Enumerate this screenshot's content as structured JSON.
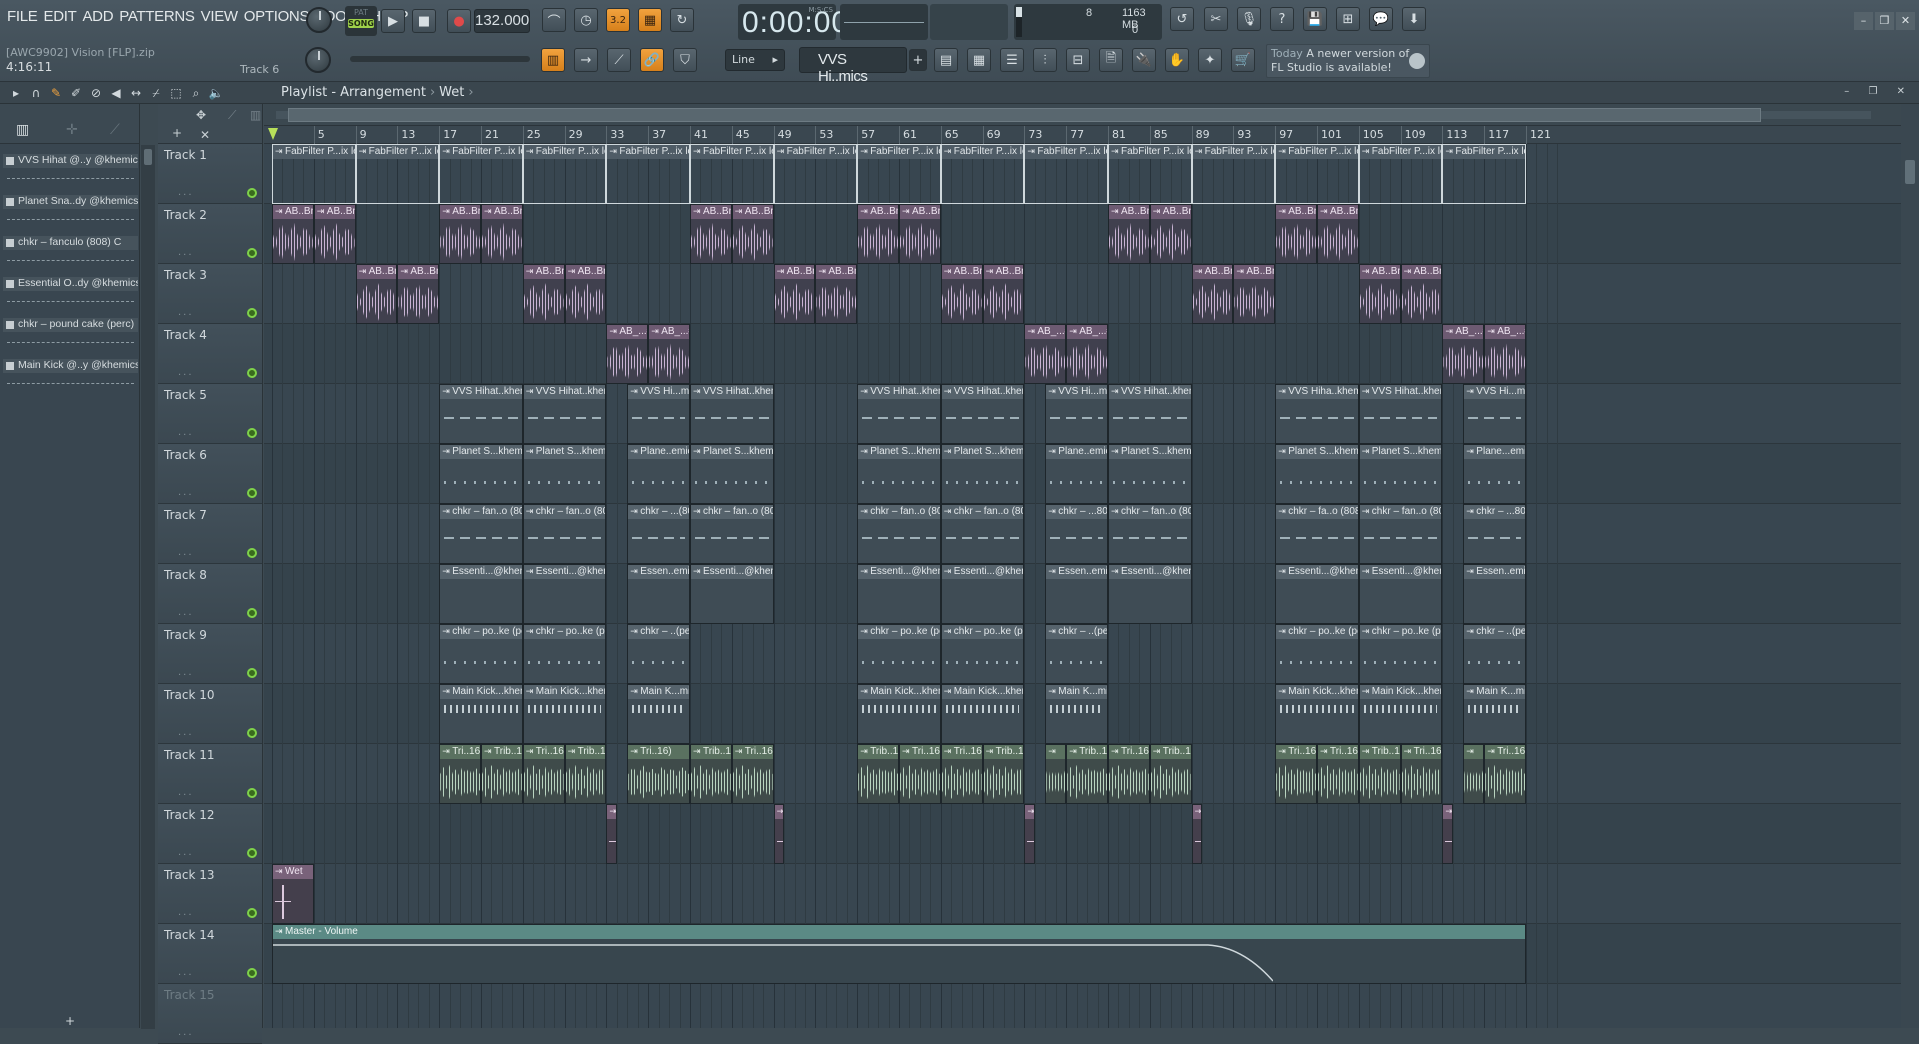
{
  "menu": [
    "FILE",
    "EDIT",
    "ADD",
    "PATTERNS",
    "VIEW",
    "OPTIONS",
    "TOOLS",
    "HELP"
  ],
  "transport": {
    "pat_label": "PAT",
    "song_label": "SONG",
    "tempo": "132.000",
    "time": "0:00:00",
    "time_unit": "M:S:CS"
  },
  "project": {
    "name": "[AWC9902] Vision [FLP].zip",
    "time": "4:16:11",
    "current_track": "Track 6"
  },
  "cpu": {
    "value1": "8",
    "ram": "1163 MB",
    "polyphony": "0"
  },
  "snap": "Line",
  "pattern_selector": "VVS Hi..mics_",
  "hint": {
    "label": "Today",
    "text": "A newer version of FL Studio is available!"
  },
  "playlist": {
    "title": "Playlist - Arrangement",
    "sub": "Wet"
  },
  "picker": [
    {
      "name": "VVS Hihat @..y @khemics_"
    },
    {
      "name": "Planet Sna..dy @khemics_"
    },
    {
      "name": "chkr – fanculo (808) C"
    },
    {
      "name": "Essential O..dy @khemics_"
    },
    {
      "name": "chkr – pound cake (perc)"
    },
    {
      "name": "Main Kick @..y @khemics_"
    }
  ],
  "ruler_labels": [
    "5",
    "9",
    "13",
    "17",
    "21",
    "25",
    "29",
    "33",
    "37",
    "41",
    "45",
    "49",
    "53",
    "57",
    "61",
    "65",
    "69",
    "73",
    "77",
    "81",
    "85",
    "89",
    "93",
    "97",
    "101",
    "105",
    "109",
    "113",
    "117",
    "121"
  ],
  "tracks": [
    "Track 1",
    "Track 2",
    "Track 3",
    "Track 4",
    "Track 5",
    "Track 6",
    "Track 7",
    "Track 8",
    "Track 9",
    "Track 10",
    "Track 11",
    "Track 12",
    "Track 13",
    "Track 14",
    "Track 15"
  ],
  "clips": [
    {
      "track": 0,
      "start": 1,
      "len": 8,
      "type": "automation",
      "label": "FabFilter P...ix level"
    },
    {
      "track": 0,
      "start": 9,
      "len": 8,
      "type": "automation",
      "label": "FabFilter P...ix level"
    },
    {
      "track": 0,
      "start": 17,
      "len": 8,
      "type": "automation",
      "label": "FabFilter P...ix level"
    },
    {
      "track": 0,
      "start": 25,
      "len": 8,
      "type": "automation",
      "label": "FabFilter P...ix level"
    },
    {
      "track": 0,
      "start": 33,
      "len": 8,
      "type": "automation",
      "label": "FabFilter P...ix level"
    },
    {
      "track": 0,
      "start": 41,
      "len": 8,
      "type": "automation",
      "label": "FabFilter P...ix level"
    },
    {
      "track": 0,
      "start": 49,
      "len": 8,
      "type": "automation",
      "label": "FabFilter P...ix level"
    },
    {
      "track": 0,
      "start": 57,
      "len": 8,
      "type": "automation",
      "label": "FabFilter P...ix level"
    },
    {
      "track": 0,
      "start": 65,
      "len": 8,
      "type": "automation",
      "label": "FabFilter P...ix level"
    },
    {
      "track": 0,
      "start": 73,
      "len": 8,
      "type": "automation",
      "label": "FabFilter P...ix level"
    },
    {
      "track": 0,
      "start": 81,
      "len": 8,
      "type": "automation",
      "label": "FabFilter P...ix level"
    },
    {
      "track": 0,
      "start": 89,
      "len": 8,
      "type": "automation",
      "label": "FabFilter P...ix level"
    },
    {
      "track": 0,
      "start": 97,
      "len": 8,
      "type": "automation",
      "label": "FabFilter P...ix level"
    },
    {
      "track": 0,
      "start": 105,
      "len": 8,
      "type": "automation",
      "label": "FabFilter P...ix level"
    },
    {
      "track": 0,
      "start": 113,
      "len": 8,
      "type": "automation",
      "label": "FabFilter P...ix level"
    },
    {
      "track": 1,
      "start": 1,
      "len": 4,
      "type": "audio-ab",
      "label": "AB..Bm"
    },
    {
      "track": 1,
      "start": 5,
      "len": 4,
      "type": "audio-ab",
      "label": "AB..Bm"
    },
    {
      "track": 1,
      "start": 17,
      "len": 4,
      "type": "audio-ab",
      "label": "AB..Bm"
    },
    {
      "track": 1,
      "start": 21,
      "len": 4,
      "type": "audio-ab",
      "label": "AB..Bm"
    },
    {
      "track": 1,
      "start": 41,
      "len": 4,
      "type": "audio-ab",
      "label": "AB..Bm"
    },
    {
      "track": 1,
      "start": 45,
      "len": 4,
      "type": "audio-ab",
      "label": "AB..Bm"
    },
    {
      "track": 1,
      "start": 57,
      "len": 4,
      "type": "audio-ab",
      "label": "AB..Bm"
    },
    {
      "track": 1,
      "start": 61,
      "len": 4,
      "type": "audio-ab",
      "label": "AB..Bm"
    },
    {
      "track": 1,
      "start": 81,
      "len": 4,
      "type": "audio-ab",
      "label": "AB..Bm"
    },
    {
      "track": 1,
      "start": 85,
      "len": 4,
      "type": "audio-ab",
      "label": "AB..Bm"
    },
    {
      "track": 1,
      "start": 97,
      "len": 4,
      "type": "audio-ab",
      "label": "AB..Bm"
    },
    {
      "track": 1,
      "start": 101,
      "len": 4,
      "type": "audio-ab",
      "label": "AB..Bm"
    },
    {
      "track": 2,
      "start": 9,
      "len": 4,
      "type": "audio-ab",
      "label": "AB..Bm"
    },
    {
      "track": 2,
      "start": 13,
      "len": 4,
      "type": "audio-ab",
      "label": "AB..Bm"
    },
    {
      "track": 2,
      "start": 25,
      "len": 4,
      "type": "audio-ab",
      "label": "AB..Bm"
    },
    {
      "track": 2,
      "start": 29,
      "len": 4,
      "type": "audio-ab",
      "label": "AB..Bm"
    },
    {
      "track": 2,
      "start": 49,
      "len": 4,
      "type": "audio-ab",
      "label": "AB..Bm"
    },
    {
      "track": 2,
      "start": 53,
      "len": 4,
      "type": "audio-ab",
      "label": "AB..Bm"
    },
    {
      "track": 2,
      "start": 65,
      "len": 4,
      "type": "audio-ab",
      "label": "AB..Bm"
    },
    {
      "track": 2,
      "start": 69,
      "len": 4,
      "type": "audio-ab",
      "label": "AB..Bm"
    },
    {
      "track": 2,
      "start": 89,
      "len": 4,
      "type": "audio-ab",
      "label": "AB..Bm"
    },
    {
      "track": 2,
      "start": 93,
      "len": 4,
      "type": "audio-ab",
      "label": "AB..Bm"
    },
    {
      "track": 2,
      "start": 105,
      "len": 4,
      "type": "audio-ab",
      "label": "AB..Bm"
    },
    {
      "track": 2,
      "start": 109,
      "len": 4,
      "type": "audio-ab",
      "label": "AB..Bm"
    },
    {
      "track": 3,
      "start": 33,
      "len": 4,
      "type": "audio-ab",
      "label": "AB_...#2"
    },
    {
      "track": 3,
      "start": 37,
      "len": 4,
      "type": "audio-ab",
      "label": "AB_...#2"
    },
    {
      "track": 3,
      "start": 73,
      "len": 4,
      "type": "audio-ab",
      "label": "AB_...#2"
    },
    {
      "track": 3,
      "start": 77,
      "len": 4,
      "type": "audio-ab",
      "label": "AB_...#2"
    },
    {
      "track": 3,
      "start": 113,
      "len": 4,
      "type": "audio-ab",
      "label": "AB_...#2"
    },
    {
      "track": 3,
      "start": 117,
      "len": 4,
      "type": "audio-ab",
      "label": "AB_...#2"
    },
    {
      "track": 4,
      "start": 17,
      "len": 8,
      "type": "pattern",
      "notes": "dash",
      "label": "VVS Hihat..khemics_"
    },
    {
      "track": 4,
      "start": 25,
      "len": 8,
      "type": "pattern",
      "notes": "dash",
      "label": "VVS Hihat..khemics_"
    },
    {
      "track": 4,
      "start": 35,
      "len": 6,
      "type": "pattern",
      "notes": "dash",
      "label": "VVS Hi...mics_"
    },
    {
      "track": 4,
      "start": 41,
      "len": 8,
      "type": "pattern",
      "notes": "dash",
      "label": "VVS Hihat..khemics_"
    },
    {
      "track": 4,
      "start": 57,
      "len": 8,
      "type": "pattern",
      "notes": "dash",
      "label": "VVS Hihat..khemics_"
    },
    {
      "track": 4,
      "start": 65,
      "len": 8,
      "type": "pattern",
      "notes": "dash",
      "label": "VVS Hihat..khemics_"
    },
    {
      "track": 4,
      "start": 75,
      "len": 6,
      "type": "pattern",
      "notes": "dash",
      "label": "VVS Hi...mics_"
    },
    {
      "track": 4,
      "start": 81,
      "len": 8,
      "type": "pattern",
      "notes": "dash",
      "label": "VVS Hihat..khemics_"
    },
    {
      "track": 4,
      "start": 97,
      "len": 8,
      "type": "pattern",
      "notes": "dash",
      "label": "VVS Hiha..khemics_"
    },
    {
      "track": 4,
      "start": 105,
      "len": 8,
      "type": "pattern",
      "notes": "dash",
      "label": "VVS Hihat..khemics_"
    },
    {
      "track": 4,
      "start": 115,
      "len": 6,
      "type": "pattern",
      "notes": "dash",
      "label": "VVS Hi...mics_"
    },
    {
      "track": 5,
      "start": 17,
      "len": 8,
      "type": "pattern",
      "notes": "dots",
      "label": "Planet S...khemics_"
    },
    {
      "track": 5,
      "start": 25,
      "len": 8,
      "type": "pattern",
      "notes": "dots",
      "label": "Planet S...khemics_"
    },
    {
      "track": 5,
      "start": 35,
      "len": 6,
      "type": "pattern",
      "notes": "dots",
      "label": "Plane..emics_"
    },
    {
      "track": 5,
      "start": 41,
      "len": 8,
      "type": "pattern",
      "notes": "dots",
      "label": "Planet S...khemics_"
    },
    {
      "track": 5,
      "start": 57,
      "len": 8,
      "type": "pattern",
      "notes": "dots",
      "label": "Planet S...khemics_"
    },
    {
      "track": 5,
      "start": 65,
      "len": 8,
      "type": "pattern",
      "notes": "dots",
      "label": "Planet S...khemics_"
    },
    {
      "track": 5,
      "start": 75,
      "len": 6,
      "type": "pattern",
      "notes": "dots",
      "label": "Plane..emics_"
    },
    {
      "track": 5,
      "start": 81,
      "len": 8,
      "type": "pattern",
      "notes": "dots",
      "label": "Planet S...khemics_"
    },
    {
      "track": 5,
      "start": 97,
      "len": 8,
      "type": "pattern",
      "notes": "dots",
      "label": "Planet S...khemics_"
    },
    {
      "track": 5,
      "start": 105,
      "len": 8,
      "type": "pattern",
      "notes": "dots",
      "label": "Planet S...khemics_"
    },
    {
      "track": 5,
      "start": 115,
      "len": 6,
      "type": "pattern",
      "notes": "dots",
      "label": "Plane...emics_"
    },
    {
      "track": 6,
      "start": 17,
      "len": 8,
      "type": "pattern",
      "notes": "dash",
      "label": "chkr – fan..o (808) C"
    },
    {
      "track": 6,
      "start": 25,
      "len": 8,
      "type": "pattern",
      "notes": "dash",
      "label": "chkr – fan..o (808) C"
    },
    {
      "track": 6,
      "start": 35,
      "len": 6,
      "type": "pattern",
      "notes": "dash",
      "label": "chkr – ...(808) C"
    },
    {
      "track": 6,
      "start": 41,
      "len": 8,
      "type": "pattern",
      "notes": "dash",
      "label": "chkr – fan..o (808) C"
    },
    {
      "track": 6,
      "start": 57,
      "len": 8,
      "type": "pattern",
      "notes": "dash",
      "label": "chkr – fan..o (808) C"
    },
    {
      "track": 6,
      "start": 65,
      "len": 8,
      "type": "pattern",
      "notes": "dash",
      "label": "chkr – fan..o (808) C"
    },
    {
      "track": 6,
      "start": 75,
      "len": 6,
      "type": "pattern",
      "notes": "dash",
      "label": "chkr – ...808) C"
    },
    {
      "track": 6,
      "start": 81,
      "len": 8,
      "type": "pattern",
      "notes": "dash",
      "label": "chkr – fan..o (808) C"
    },
    {
      "track": 6,
      "start": 97,
      "len": 8,
      "type": "pattern",
      "notes": "dash",
      "label": "chkr – fa..o (808) C"
    },
    {
      "track": 6,
      "start": 105,
      "len": 8,
      "type": "pattern",
      "notes": "dash",
      "label": "chkr – fan..o (808) C"
    },
    {
      "track": 6,
      "start": 115,
      "len": 6,
      "type": "pattern",
      "notes": "dash",
      "label": "chkr – ...808) C"
    },
    {
      "track": 7,
      "start": 17,
      "len": 8,
      "type": "pattern",
      "notes": "none",
      "label": "Essenti...@khemics_"
    },
    {
      "track": 7,
      "start": 25,
      "len": 8,
      "type": "pattern",
      "notes": "none",
      "label": "Essenti...@khemics_"
    },
    {
      "track": 7,
      "start": 35,
      "len": 6,
      "type": "pattern",
      "notes": "none",
      "label": "Essen..emics_"
    },
    {
      "track": 7,
      "start": 41,
      "len": 8,
      "type": "pattern",
      "notes": "none",
      "label": "Essenti...@khemics_"
    },
    {
      "track": 7,
      "start": 57,
      "len": 8,
      "type": "pattern",
      "notes": "none",
      "label": "Essenti...@khemics_"
    },
    {
      "track": 7,
      "start": 65,
      "len": 8,
      "type": "pattern",
      "notes": "none",
      "label": "Essenti...@khemics_"
    },
    {
      "track": 7,
      "start": 75,
      "len": 6,
      "type": "pattern",
      "notes": "none",
      "label": "Essen..emics_"
    },
    {
      "track": 7,
      "start": 81,
      "len": 8,
      "type": "pattern",
      "notes": "none",
      "label": "Essenti...@khemics_"
    },
    {
      "track": 7,
      "start": 97,
      "len": 8,
      "type": "pattern",
      "notes": "none",
      "label": "Essenti...@khemics_"
    },
    {
      "track": 7,
      "start": 105,
      "len": 8,
      "type": "pattern",
      "notes": "none",
      "label": "Essenti...@khemics_"
    },
    {
      "track": 7,
      "start": 115,
      "len": 6,
      "type": "pattern",
      "notes": "none",
      "label": "Essen..emics_"
    },
    {
      "track": 8,
      "start": 17,
      "len": 8,
      "type": "pattern",
      "notes": "dots",
      "label": "chkr – po..ke (perc)"
    },
    {
      "track": 8,
      "start": 25,
      "len": 8,
      "type": "pattern",
      "notes": "dots",
      "label": "chkr – po..ke (perc)"
    },
    {
      "track": 8,
      "start": 35,
      "len": 6,
      "type": "pattern",
      "notes": "dots",
      "label": "chkr – ..(perc)"
    },
    {
      "track": 8,
      "start": 57,
      "len": 8,
      "type": "pattern",
      "notes": "dots",
      "label": "chkr – po..ke (perc)"
    },
    {
      "track": 8,
      "start": 65,
      "len": 8,
      "type": "pattern",
      "notes": "dots",
      "label": "chkr – po..ke (perc)"
    },
    {
      "track": 8,
      "start": 75,
      "len": 6,
      "type": "pattern",
      "notes": "dots",
      "label": "chkr – ..(perc)"
    },
    {
      "track": 8,
      "start": 97,
      "len": 8,
      "type": "pattern",
      "notes": "dots",
      "label": "chkr – po..ke (perc)"
    },
    {
      "track": 8,
      "start": 105,
      "len": 8,
      "type": "pattern",
      "notes": "dots",
      "label": "chkr – po..ke (perc)"
    },
    {
      "track": 8,
      "start": 115,
      "len": 6,
      "type": "pattern",
      "notes": "dots",
      "label": "chkr – ..(perc)"
    },
    {
      "track": 9,
      "start": 17,
      "len": 8,
      "type": "pattern",
      "notes": "kick",
      "label": "Main Kick...khemics_"
    },
    {
      "track": 9,
      "start": 25,
      "len": 8,
      "type": "pattern",
      "notes": "kick",
      "label": "Main Kick...khemics_"
    },
    {
      "track": 9,
      "start": 35,
      "len": 6,
      "type": "pattern",
      "notes": "kick",
      "label": "Main K...mics_"
    },
    {
      "track": 9,
      "start": 57,
      "len": 8,
      "type": "pattern",
      "notes": "kick",
      "label": "Main Kick...khemics_"
    },
    {
      "track": 9,
      "start": 65,
      "len": 8,
      "type": "pattern",
      "notes": "kick",
      "label": "Main Kick...khemics_"
    },
    {
      "track": 9,
      "start": 75,
      "len": 6,
      "type": "pattern",
      "notes": "kick",
      "label": "Main K...mics_"
    },
    {
      "track": 9,
      "start": 97,
      "len": 8,
      "type": "pattern",
      "notes": "kick",
      "label": "Main Kick...khemics_"
    },
    {
      "track": 9,
      "start": 105,
      "len": 8,
      "type": "pattern",
      "notes": "kick",
      "label": "Main Kick...khemics_"
    },
    {
      "track": 9,
      "start": 115,
      "len": 6,
      "type": "pattern",
      "notes": "kick",
      "label": "Main K...mics_"
    },
    {
      "track": 10,
      "start": 17,
      "len": 4,
      "type": "audio-tri",
      "label": "Tri..16)"
    },
    {
      "track": 10,
      "start": 21,
      "len": 4,
      "type": "audio-tri",
      "label": "Trib..16)"
    },
    {
      "track": 10,
      "start": 25,
      "len": 4,
      "type": "audio-tri",
      "label": "Tri..16)"
    },
    {
      "track": 10,
      "start": 29,
      "len": 4,
      "type": "audio-tri",
      "label": "Trib..16)"
    },
    {
      "track": 10,
      "start": 35,
      "len": 6,
      "type": "audio-tri",
      "label": "Tri..16)"
    },
    {
      "track": 10,
      "start": 41,
      "len": 4,
      "type": "audio-tri",
      "label": "Trib..16)"
    },
    {
      "track": 10,
      "start": 45,
      "len": 4,
      "type": "audio-tri",
      "label": "Tri..16)"
    },
    {
      "track": 10,
      "start": 57,
      "len": 4,
      "type": "audio-tri",
      "label": "Trib..16)"
    },
    {
      "track": 10,
      "start": 61,
      "len": 4,
      "type": "audio-tri",
      "label": "Tri..16)"
    },
    {
      "track": 10,
      "start": 65,
      "len": 4,
      "type": "audio-tri",
      "label": "Tri..16)"
    },
    {
      "track": 10,
      "start": 69,
      "len": 4,
      "type": "audio-tri",
      "label": "Trib..16)"
    },
    {
      "track": 10,
      "start": 75,
      "len": 2,
      "type": "audio-tri",
      "label": ""
    },
    {
      "track": 10,
      "start": 77,
      "len": 4,
      "type": "audio-tri",
      "label": "Trib..16)"
    },
    {
      "track": 10,
      "start": 81,
      "len": 4,
      "type": "audio-tri",
      "label": "Tri..16)"
    },
    {
      "track": 10,
      "start": 85,
      "len": 4,
      "type": "audio-tri",
      "label": "Trib..16)"
    },
    {
      "track": 10,
      "start": 97,
      "len": 4,
      "type": "audio-tri",
      "label": "Tri..16)"
    },
    {
      "track": 10,
      "start": 101,
      "len": 4,
      "type": "audio-tri",
      "label": "Tri..16)"
    },
    {
      "track": 10,
      "start": 105,
      "len": 4,
      "type": "audio-tri",
      "label": "Trib..16)"
    },
    {
      "track": 10,
      "start": 109,
      "len": 4,
      "type": "audio-tri",
      "label": "Tri..16)"
    },
    {
      "track": 10,
      "start": 115,
      "len": 2,
      "type": "audio-tri",
      "label": ""
    },
    {
      "track": 10,
      "start": 117,
      "len": 4,
      "type": "audio-tri",
      "label": "Tri..16)"
    },
    {
      "track": 11,
      "start": 33,
      "len": 1,
      "type": "audio-perc",
      "label": ""
    },
    {
      "track": 11,
      "start": 49,
      "len": 1,
      "type": "audio-perc",
      "label": ""
    },
    {
      "track": 11,
      "start": 73,
      "len": 1,
      "type": "audio-perc",
      "label": ""
    },
    {
      "track": 11,
      "start": 89,
      "len": 1,
      "type": "audio-perc",
      "label": ""
    },
    {
      "track": 11,
      "start": 113,
      "len": 1,
      "type": "audio-perc",
      "label": ""
    },
    {
      "track": 12,
      "start": 1,
      "len": 4,
      "type": "audio-perc",
      "label": "Wet"
    },
    {
      "track": 13,
      "start": 1,
      "len": 120,
      "type": "master",
      "label": "Master - Volume"
    }
  ],
  "colors": {
    "accent": "#f0a33f",
    "song": "#9fd24a",
    "bg": "#3d4a52"
  }
}
